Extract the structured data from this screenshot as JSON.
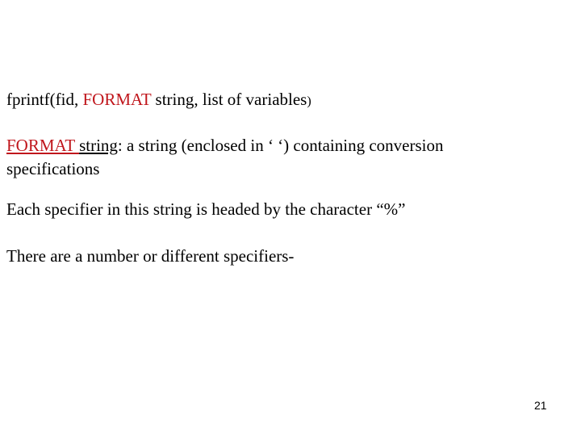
{
  "slide": {
    "line1": {
      "prefix": "fprintf(fid, ",
      "highlight": "FORMAT",
      "suffix": " string, list of variables",
      "close_paren": ")"
    },
    "line2": {
      "highlight": "FORMAT ",
      "underlined": "string",
      "rest": ": a string (enclosed in ‘ ‘) containing conversion"
    },
    "line3": "specifications",
    "line4": "Each specifier in this string is headed  by the character “%”",
    "line5": "There are a number or different specifiers-",
    "page_number": "21"
  },
  "colors": {
    "accent_red": "#c0161c"
  }
}
